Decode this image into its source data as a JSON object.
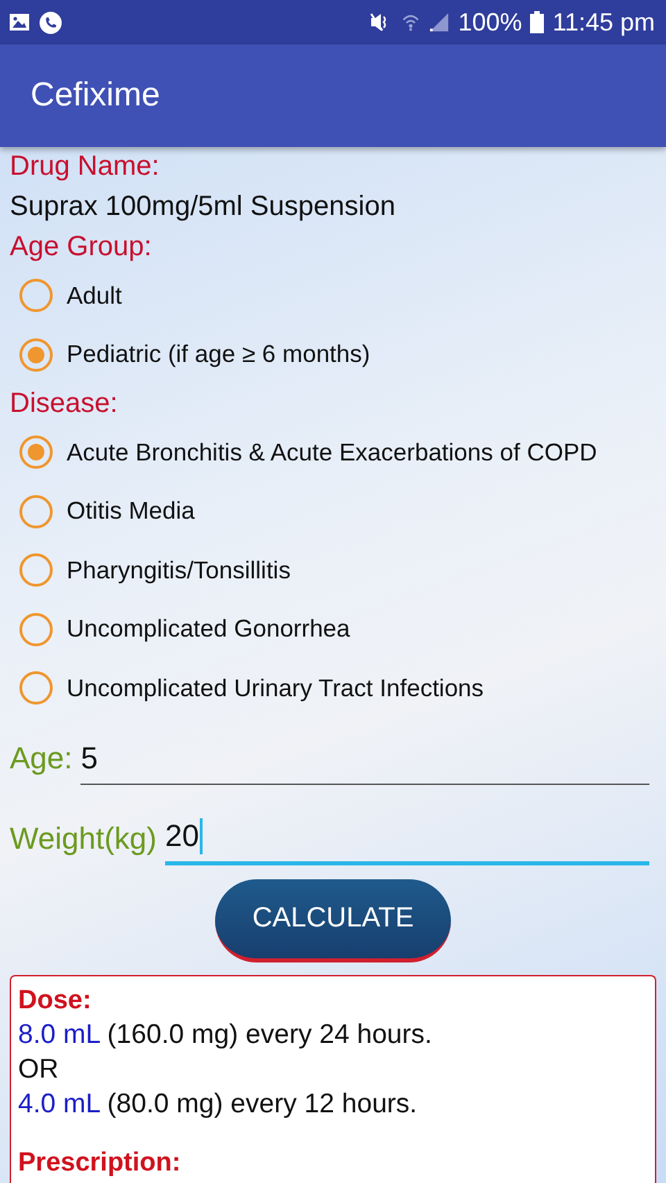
{
  "status_bar": {
    "battery": "100%",
    "time": "11:45 pm"
  },
  "app_bar": {
    "title": "Cefixime"
  },
  "drug": {
    "label": "Drug Name:",
    "value": "Suprax 100mg/5ml Suspension"
  },
  "age_group": {
    "label": "Age Group:",
    "options": [
      {
        "label": "Adult",
        "selected": false
      },
      {
        "label": "Pediatric (if age ≥ 6 months)",
        "selected": true
      }
    ]
  },
  "disease": {
    "label": "Disease:",
    "options": [
      {
        "label": "Acute Bronchitis & Acute Exacerbations of COPD",
        "selected": true
      },
      {
        "label": "Otitis Media",
        "selected": false
      },
      {
        "label": "Pharyngitis/Tonsillitis",
        "selected": false
      },
      {
        "label": "Uncomplicated Gonorrhea",
        "selected": false
      },
      {
        "label": "Uncomplicated Urinary Tract Infections",
        "selected": false
      }
    ]
  },
  "fields": [
    {
      "label": "Age:",
      "value": "5",
      "focused": false
    },
    {
      "label": "Weight(kg)",
      "value": "20",
      "focused": true
    }
  ],
  "calculate_button": "CALCULATE",
  "result": {
    "dose_label": "Dose:",
    "lines": [
      {
        "amount": "8.0 mL",
        "text": " (160.0 mg) every 24 hours."
      },
      {
        "text": "OR"
      },
      {
        "amount": "4.0 mL",
        "text": " (80.0 mg) every 12 hours."
      }
    ],
    "prescription_label": "Prescription:"
  }
}
